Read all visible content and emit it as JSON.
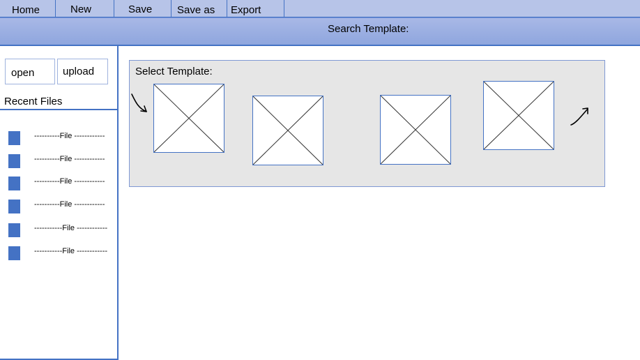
{
  "menu": {
    "items": [
      {
        "label": "Home"
      },
      {
        "label": "New"
      },
      {
        "label": "Save"
      },
      {
        "label": "Save as"
      },
      {
        "label": "Export"
      }
    ]
  },
  "search": {
    "label": "Search Template:"
  },
  "sidebar": {
    "open_label": "open",
    "upload_label": "upload",
    "recent_title": "Recent Files",
    "files": [
      {
        "label": "----------File ------------"
      },
      {
        "label": "----------File ------------"
      },
      {
        "label": "----------File ------------"
      },
      {
        "label": "----------File ------------"
      },
      {
        "label": "-----------File ------------"
      },
      {
        "label": "-----------File ------------"
      }
    ]
  },
  "templates": {
    "title": "Select Template:",
    "prev_icon": "curved-arrow-down-right",
    "next_icon": "curved-arrow-up-right",
    "items": [
      {
        "icon": "image-placeholder-icon"
      },
      {
        "icon": "image-placeholder-icon"
      },
      {
        "icon": "image-placeholder-icon"
      },
      {
        "icon": "image-placeholder-icon"
      }
    ]
  },
  "colors": {
    "accent": "#4472c4",
    "menubar": "#b7c4e8",
    "searchbar": "#9aaee2",
    "panel": "#e6e6e6"
  }
}
